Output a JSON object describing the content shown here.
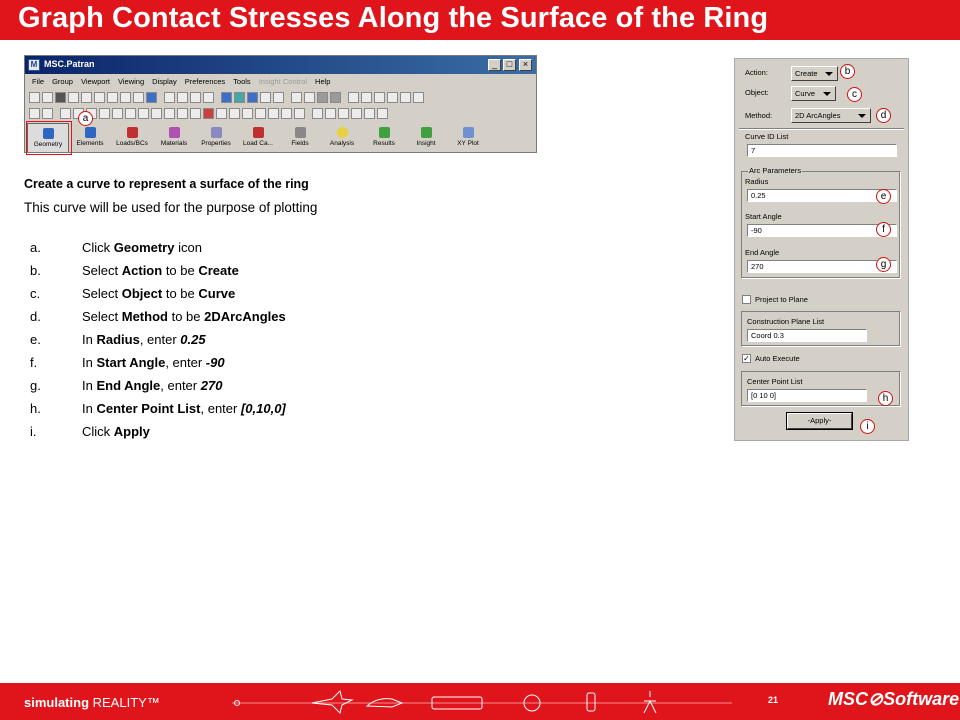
{
  "title": "Graph Contact Stresses Along the Surface of the Ring",
  "window": {
    "name": "MSC.Patran",
    "menus": [
      "File",
      "Group",
      "Viewport",
      "Viewing",
      "Display",
      "Preferences",
      "Tools",
      "Insight Control",
      "Help"
    ],
    "apps": [
      "Geometry",
      "Elements",
      "Loads/BCs",
      "Materials",
      "Properties",
      "Load Ca...",
      "Fields",
      "Analysis",
      "Results",
      "Insight",
      "XY Plot"
    ]
  },
  "markers": {
    "a": "a",
    "b": "b",
    "c": "c",
    "d": "d",
    "e": "e",
    "f": "f",
    "g": "g",
    "h": "h",
    "i": "i"
  },
  "heading": "Create a curve to represent a surface of the ring",
  "subtext": "This curve will be used for the purpose of plotting",
  "steps": [
    {
      "letter": "a.",
      "pre": "Click ",
      "bold": "Geometry",
      "post": " icon",
      "mid": "",
      "value": ""
    },
    {
      "letter": "b.",
      "pre": "Select ",
      "bold": "Action",
      "mid": " to be ",
      "value": "Create",
      "post": ""
    },
    {
      "letter": "c.",
      "pre": "Select ",
      "bold": "Object",
      "mid": " to be ",
      "value": "Curve",
      "post": ""
    },
    {
      "letter": "d.",
      "pre": "Select ",
      "bold": "Method",
      "mid": " to be ",
      "value": "2DArcAngles",
      "post": ""
    },
    {
      "letter": "e.",
      "pre": "In ",
      "bold": "Radius",
      "mid": ", enter ",
      "value": "0.25",
      "post": ""
    },
    {
      "letter": "f.",
      "pre": "In ",
      "bold": "Start Angle",
      "mid": ", enter ",
      "value": "-90",
      "post": ""
    },
    {
      "letter": "g.",
      "pre": "In ",
      "bold": "End Angle",
      "mid": ", enter ",
      "value": "270",
      "post": ""
    },
    {
      "letter": "h.",
      "pre": "In ",
      "bold": "Center Point List",
      "mid": ", enter ",
      "value": "[0,10,0]",
      "post": ""
    },
    {
      "letter": "i.",
      "pre": "Click ",
      "bold": "Apply",
      "mid": "",
      "value": "",
      "post": ""
    }
  ],
  "panel": {
    "action_label": "Action:",
    "action_value": "Create",
    "object_label": "Object:",
    "object_value": "Curve",
    "method_label": "Method:",
    "method_value": "2D ArcAngles",
    "curve_id_label": "Curve ID List",
    "curve_id_value": "7",
    "arc_params_label": "Arc Parameters",
    "radius_label": "Radius",
    "radius_value": "0.25",
    "start_angle_label": "Start Angle",
    "start_angle_value": "-90",
    "end_angle_label": "End Angle",
    "end_angle_value": "270",
    "project_label": "Project to Plane",
    "project_checked": "",
    "construction_label": "Construction Plane List",
    "construction_value": "Coord 0.3",
    "auto_execute_label": "Auto Execute",
    "auto_execute_checked": "✓",
    "center_point_label": "Center Point List",
    "center_point_value": "[0 10 0]",
    "apply_label": "-Apply-"
  },
  "footer": {
    "left_bold": "simulating",
    "left_rest": " REALITY™",
    "page": "21",
    "logo": "MSC⊘Software"
  },
  "colors": {
    "brand_red": "#e0141b",
    "window_gray": "#d4d0c8"
  }
}
